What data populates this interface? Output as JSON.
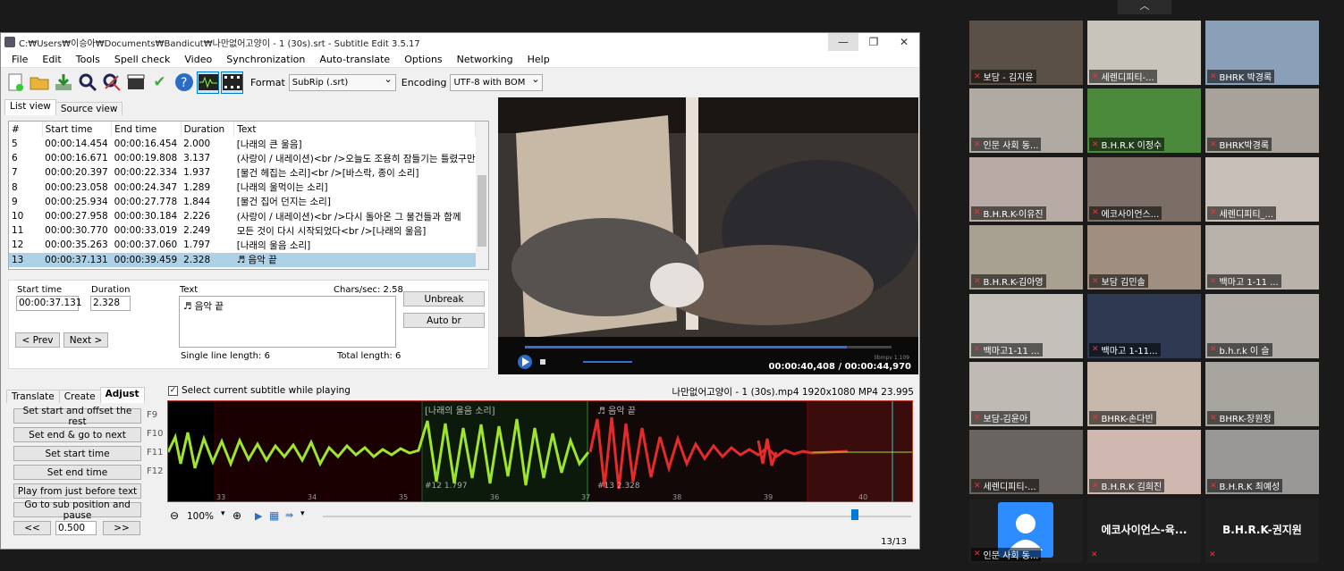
{
  "app": {
    "title": "C:₩Users₩이승아₩Documents₩Bandicut₩나만없어고양이 - 1 (30s).srt - Subtitle Edit 3.5.17",
    "min": "—",
    "max": "❐",
    "close": "✕"
  },
  "menu": [
    "File",
    "Edit",
    "Tools",
    "Spell check",
    "Video",
    "Synchronization",
    "Auto-translate",
    "Options",
    "Networking",
    "Help"
  ],
  "toolbar": {
    "format_label": "Format",
    "format_value": "SubRip (.srt)",
    "encoding_label": "Encoding",
    "encoding_value": "UTF-8 with BOM"
  },
  "views": {
    "list": "List view",
    "source": "Source view"
  },
  "grid": {
    "headers": [
      "#",
      "Start time",
      "End time",
      "Duration",
      "Text"
    ],
    "rows": [
      [
        "5",
        "00:00:14.454",
        "00:00:16.454",
        "2.000",
        "[나래의 큰 울음]"
      ],
      [
        "6",
        "00:00:16.671",
        "00:00:19.808",
        "3.137",
        "(사랑이 / 내레이션)<br />오늘도 조용히 잠들기는 틀렸구만"
      ],
      [
        "7",
        "00:00:20.397",
        "00:00:22.334",
        "1.937",
        "[물건 헤집는 소리]<br />[바스락, 종이 소리]"
      ],
      [
        "8",
        "00:00:23.058",
        "00:00:24.347",
        "1.289",
        "[나래의 울먹이는 소리]"
      ],
      [
        "9",
        "00:00:25.934",
        "00:00:27.778",
        "1.844",
        "[물건 집어 던지는 소리]"
      ],
      [
        "10",
        "00:00:27.958",
        "00:00:30.184",
        "2.226",
        "(사랑이 / 내레이션)<br />다시 돌아온 그 물건들과 함께"
      ],
      [
        "11",
        "00:00:30.770",
        "00:00:33.019",
        "2.249",
        "모든 것이 다시 시작되었다<br />[나래의 울음]"
      ],
      [
        "12",
        "00:00:35.263",
        "00:00:37.060",
        "1.797",
        "[나래의 울음 소리]"
      ],
      [
        "13",
        "00:00:37.131",
        "00:00:39.459",
        "2.328",
        "♬ 음악 끝"
      ]
    ]
  },
  "edit": {
    "start_label": "Start time",
    "start_value": "00:00:37.131",
    "dur_label": "Duration",
    "dur_value": "2.328",
    "text_label": "Text",
    "chars": "Chars/sec: 2.58",
    "text_value": "♬ 음악 끝",
    "single": "Single line length: 6",
    "total": "Total length: 6",
    "prev": "< Prev",
    "next": "Next >",
    "unbreak": "Unbreak",
    "autobr": "Auto br"
  },
  "video": {
    "time": "00:00:40,408 / 00:00:44,970",
    "brand": "libmpv 1.109"
  },
  "bottom": {
    "tabs": [
      "Translate",
      "Create",
      "Adjust"
    ],
    "select_current": "Select current subtitle while playing",
    "media_info": "나만없어고양이 - 1 (30s).mp4 1920x1080 MP4 23.995",
    "buttons": [
      {
        "label": "Set start and offset the rest",
        "key": "F9"
      },
      {
        "label": "Set end & go to next",
        "key": "F10"
      },
      {
        "label": "Set start time",
        "key": "F11"
      },
      {
        "label": "Set end time",
        "key": "F12"
      },
      {
        "label": "Play from just before text",
        "key": ""
      },
      {
        "label": "Go to sub position and pause",
        "key": ""
      }
    ],
    "step_prev": "<<",
    "step_value": "0.500",
    "step_next": ">>"
  },
  "wave": {
    "seg_labels": [
      "[나래의 울음 소리]",
      "♬ 음악 끝"
    ],
    "seg_info": [
      "#12 1.797",
      "#13 2.328"
    ],
    "ticks": [
      "33",
      "34",
      "35",
      "36",
      "37",
      "38",
      "39",
      "40"
    ],
    "zoom": "100%"
  },
  "status": "13/13",
  "participants": [
    {
      "name": "보담 - 김지윤",
      "bg": "#5a5048"
    },
    {
      "name": "세렌디피티-...",
      "bg": "#c8c4bc"
    },
    {
      "name": "BHRK 박경록",
      "bg": "#8aa0b8"
    },
    {
      "name": "인문 사회 동...",
      "bg": "#b0aaa2"
    },
    {
      "name": "B.H.R.K 이정수",
      "bg": "#4a8a3a"
    },
    {
      "name": "BHRK박경록",
      "bg": "#a8a29a"
    },
    {
      "name": "B.H.R.K-이유진",
      "bg": "#b8aaa4"
    },
    {
      "name": "에코사이언스...",
      "bg": "#7a6e66"
    },
    {
      "name": "세렌디피티_...",
      "bg": "#c8c0b8"
    },
    {
      "name": "B.H.R.K-김아영",
      "bg": "#a8a090"
    },
    {
      "name": "보담 김민솔",
      "bg": "#a08e80"
    },
    {
      "name": "백마고 1-11 ...",
      "bg": "#b8b2aa"
    },
    {
      "name": "백마고1-11 ...",
      "bg": "#c4c0ba"
    },
    {
      "name": "백마고 1-11...",
      "bg": "#2e3a52"
    },
    {
      "name": "b.h.r.k 이 슬",
      "bg": "#b2aca6"
    },
    {
      "name": "보담-김윤아",
      "bg": "#c0bab4"
    },
    {
      "name": "BHRK-손다빈",
      "bg": "#c8b8ac"
    },
    {
      "name": "BHRK-장원정",
      "bg": "#a8a49e"
    },
    {
      "name": "세렌디피티-...",
      "bg": "#6a6460"
    },
    {
      "name": "B.H.R.K 김희진",
      "bg": "#d0b8b0"
    },
    {
      "name": "B.H.R.K 최예성",
      "bg": "#9a9896"
    },
    {
      "name": "인문 사회 동...",
      "bg": "#1f1f1f"
    },
    {
      "name": "에코사이언스-육...",
      "bg": "#1f1f1f"
    },
    {
      "name": "B.H.R.K-권지원",
      "bg": "#1f1f1f"
    }
  ]
}
